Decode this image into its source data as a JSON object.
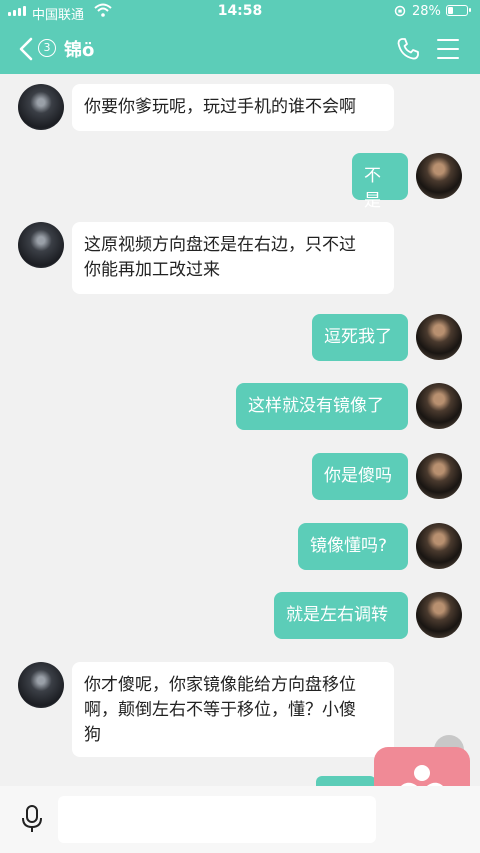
{
  "status_bar": {
    "carrier": "中国联通",
    "time": "14:58",
    "battery_pct": "28%",
    "battery_level": 0.28
  },
  "header": {
    "unread_count": "3",
    "title": "锦ö",
    "icons": [
      "back-chevron-icon",
      "phone-icon",
      "menu-icon"
    ]
  },
  "messages": [
    {
      "side": "in",
      "text": "你要你爹玩呢，玩过手机的谁不会啊"
    },
    {
      "side": "out",
      "text": "不是"
    },
    {
      "side": "in",
      "text": "这原视频方向盘还是在右边，只不过\n你能再加工改过来"
    },
    {
      "side": "out",
      "text": "逗死我了"
    },
    {
      "side": "out",
      "text": "这样就没有镜像了"
    },
    {
      "side": "out",
      "text": "你是傻吗"
    },
    {
      "side": "out",
      "text": "镜像懂吗?"
    },
    {
      "side": "out",
      "text": "就是左右调转"
    },
    {
      "side": "in",
      "text": "你才傻呢，你家镜像能给方向盘移位\n啊，颠倒左右不等于移位，懂？小傻\n狗"
    }
  ],
  "input": {
    "value": "",
    "placeholder": ""
  },
  "colors": {
    "accent": "#5ccdb8",
    "floating_button": "#f08a96",
    "background": "#f1f1f1"
  }
}
